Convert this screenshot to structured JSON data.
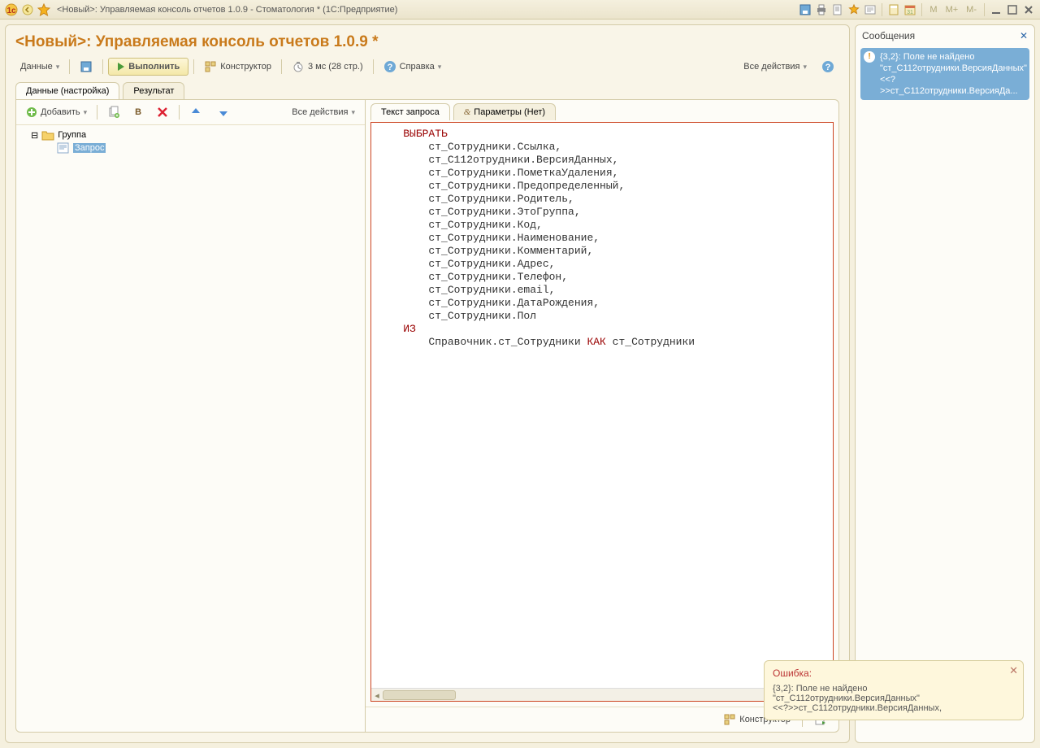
{
  "titlebar": {
    "title": "<Новый>: Управляемая консоль отчетов 1.0.9 - Стоматология *  (1С:Предприятие)",
    "mbuttons": [
      "M",
      "M+",
      "M-"
    ]
  },
  "heading": "<Новый>: Управляемая консоль отчетов 1.0.9 *",
  "toolbar": {
    "data": "Данные",
    "execute": "Выполнить",
    "constructor": "Конструктор",
    "timing": "3 мс (28 стр.)",
    "help": "Справка",
    "all_actions": "Все действия"
  },
  "tabs_main": {
    "settings": "Данные (настройка)",
    "result": "Результат"
  },
  "treebar": {
    "add": "Добавить",
    "b": "В",
    "all_actions": "Все действия"
  },
  "tree": {
    "group": "Группа",
    "query": "Запрос"
  },
  "tabs_query": {
    "text": "Текст запроса",
    "params": "Параметры (Нет)"
  },
  "query_lines": [
    {
      "indent": 0,
      "kw": true,
      "text": "ВЫБРАТЬ"
    },
    {
      "indent": 1,
      "text": "ст_Сотрудники.Ссылка,"
    },
    {
      "indent": 1,
      "text": "ст_С112отрудники.ВерсияДанных,"
    },
    {
      "indent": 1,
      "text": "ст_Сотрудники.ПометкаУдаления,"
    },
    {
      "indent": 1,
      "text": "ст_Сотрудники.Предопределенный,"
    },
    {
      "indent": 1,
      "text": "ст_Сотрудники.Родитель,"
    },
    {
      "indent": 1,
      "text": "ст_Сотрудники.ЭтоГруппа,"
    },
    {
      "indent": 1,
      "text": "ст_Сотрудники.Код,"
    },
    {
      "indent": 1,
      "text": "ст_Сотрудники.Наименование,"
    },
    {
      "indent": 1,
      "text": "ст_Сотрудники.Комментарий,"
    },
    {
      "indent": 1,
      "text": "ст_Сотрудники.Адрес,"
    },
    {
      "indent": 1,
      "text": "ст_Сотрудники.Телефон,"
    },
    {
      "indent": 1,
      "text": "ст_Сотрудники.email,"
    },
    {
      "indent": 1,
      "text": "ст_Сотрудники.ДатаРождения,"
    },
    {
      "indent": 1,
      "text": "ст_Сотрудники.Пол"
    },
    {
      "indent": 0,
      "kw": true,
      "text": "ИЗ"
    },
    {
      "indent": 1,
      "mix": [
        "Справочник.ст_Сотрудники ",
        {
          "kw": "КАК"
        },
        " ст_Сотрудники"
      ]
    }
  ],
  "bottom": {
    "constructor": "Конструктор"
  },
  "error": {
    "title": "Ошибка:",
    "body": "{3,2}: Поле не найдено \"ст_С112отрудники.ВерсияДанных\"\n<<?>>ст_С112отрудники.ВерсияДанных,"
  },
  "messages": {
    "title": "Сообщения",
    "item": "{3,2}: Поле не найдено \"ст_С112отрудники.ВерсияДанных\" <<?>>ст_С112отрудники.ВерсияДа..."
  }
}
